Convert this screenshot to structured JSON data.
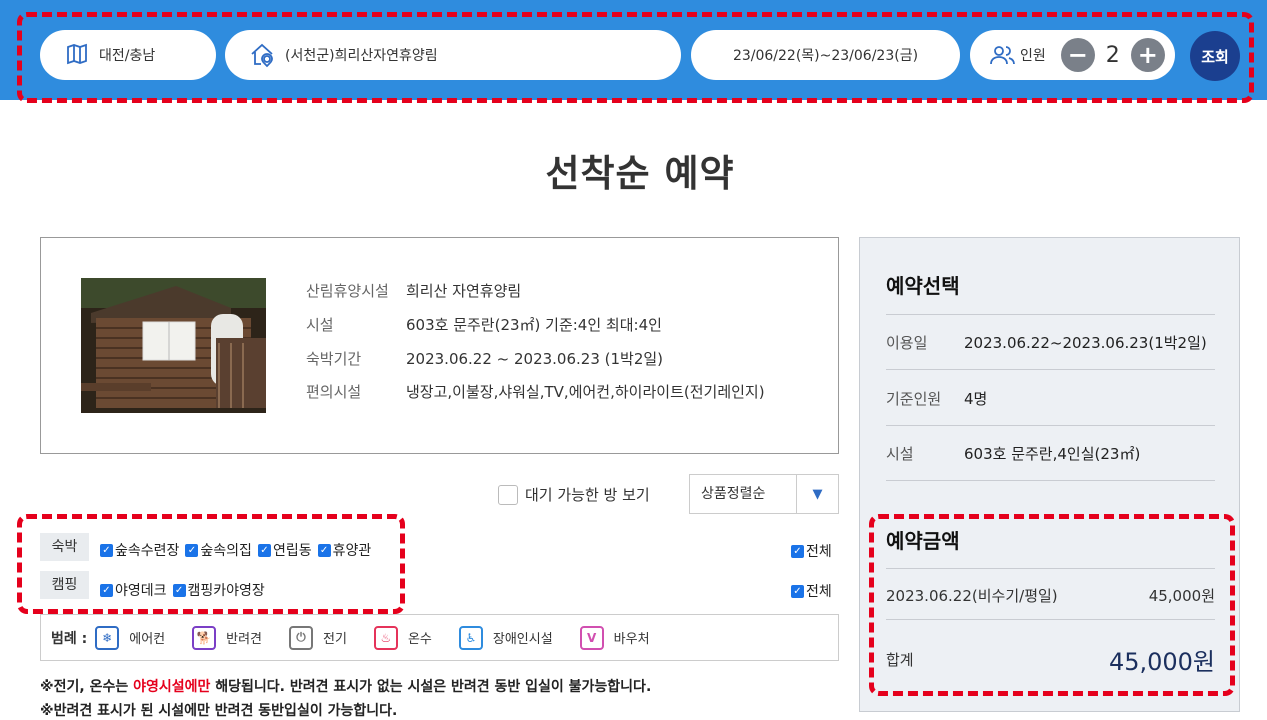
{
  "search": {
    "region": "대전/충남",
    "facility": "(서천군)희리산자연휴양림",
    "dates": "23/06/22(목)~23/06/23(금)",
    "people_label": "인원",
    "people_count": "2",
    "minus": "−",
    "plus": "+",
    "search_label": "조회"
  },
  "page_title": "선착순 예약",
  "info": {
    "rows": [
      {
        "key": "산림휴양시설",
        "value": "희리산 자연휴양림"
      },
      {
        "key": "시설",
        "value": "603호 문주란(23㎡) 기준:4인 최대:4인"
      },
      {
        "key": "숙박기간",
        "value": "2023.06.22 ~ 2023.06.23 (1박2일)"
      },
      {
        "key": "편의시설",
        "value": "냉장고,이불장,샤워실,TV,에어컨,하이라이트(전기레인지)"
      }
    ]
  },
  "controls": {
    "waitlist_label": "대기 가능한 방 보기",
    "sort_label": "상품정렬순",
    "sort_arrow": "▼"
  },
  "filters": {
    "lodging_tag": "숙박",
    "lodging_items": [
      "숲속수련장",
      "숲속의집",
      "연립동",
      "휴양관"
    ],
    "camping_tag": "캠핑",
    "camping_items": [
      "야영데크",
      "캠핑카야영장"
    ],
    "all_label": "전체",
    "check": "✓"
  },
  "legend": {
    "title": "범례 :",
    "items": [
      {
        "label": "에어컨",
        "icon": "air-conditioner-icon",
        "color": "#2f6cc4",
        "glyph": "❄"
      },
      {
        "label": "반려견",
        "icon": "pet-icon",
        "color": "#7b3fc6",
        "glyph": "🐕"
      },
      {
        "label": "전기",
        "icon": "plug-icon",
        "color": "#777777",
        "glyph": "⏻"
      },
      {
        "label": "온수",
        "icon": "hot-water-icon",
        "color": "#e5335a",
        "glyph": "♨"
      },
      {
        "label": "장애인시설",
        "icon": "accessibility-icon",
        "color": "#2f8cde",
        "glyph": "♿"
      },
      {
        "label": "바우처",
        "icon": "voucher-icon",
        "color": "#d14fb0",
        "glyph": "V"
      }
    ]
  },
  "notice": {
    "line1_a": "※전기, 온수는 ",
    "line1_red": "야영시설에만",
    "line1_b": " 해당됩니다. 반려견 표시가 없는 시설은 반려견 동반 입실이 불가능합니다.",
    "line2": "※반려견 표시가 된 시설에만 반려견 동반입실이 가능합니다."
  },
  "panel": {
    "select_title": "예약선택",
    "rows": [
      {
        "key": "이용일",
        "value": "2023.06.22~2023.06.23(1박2일)"
      },
      {
        "key": "기준인원",
        "value": "4명"
      },
      {
        "key": "시설",
        "value": "603호 문주란,4인실(23㎡)"
      }
    ],
    "amount_title": "예약금액",
    "amount_item": {
      "label": "2023.06.22(비수기/평일)",
      "value": "45,000원"
    },
    "total": {
      "label": "합계",
      "value": "45,000원"
    }
  },
  "colors": {
    "accent": "#2f8cde",
    "highlight": "#e5001c",
    "button": "#1b3f8f"
  }
}
